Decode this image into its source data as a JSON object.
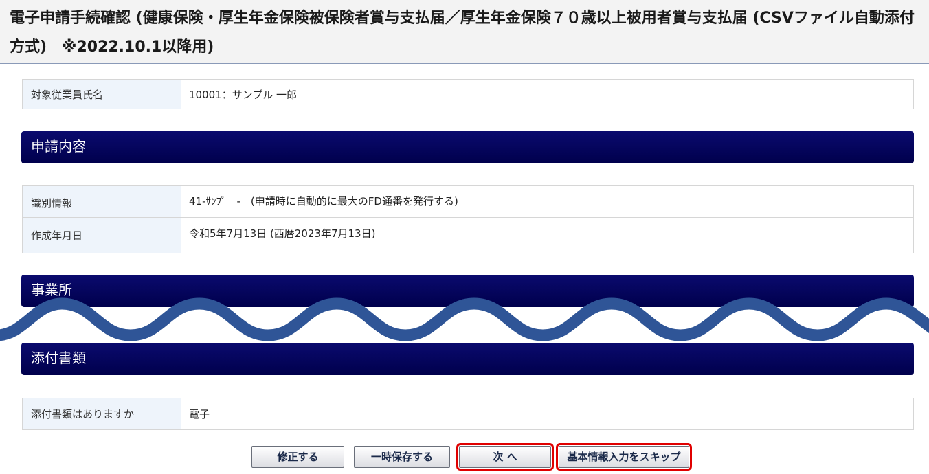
{
  "header": {
    "title": "電子申請手続確認 (健康保険・厚生年金保険被保険者賞与支払届／厚生年金保険７０歳以上被用者賞与支払届 (CSVファイル自動添付方式)　※2022.10.1以降用)"
  },
  "employee": {
    "label": "対象従業員氏名",
    "value": "10001：サンプル 一郎"
  },
  "sections": {
    "application": "申請内容",
    "office": "事業所",
    "attachments": "添付書類"
  },
  "application": {
    "rows": [
      {
        "label": "識別情報",
        "value": "41-ｻﾝﾌﾟ　-　(申請時に自動的に最大のFD通番を発行する)"
      },
      {
        "label": "作成年月日",
        "value": "令和5年7月13日 (西暦2023年7月13日)"
      }
    ]
  },
  "attachments": {
    "label": "添付書類はありますか",
    "value": "電子"
  },
  "buttons": {
    "modify": "修正する",
    "save_temp": "一時保存する",
    "next": "次 へ",
    "skip": "基本情報入力をスキップ"
  },
  "colors": {
    "section_header": "#00004c",
    "highlight": "#e00000",
    "wave": "#2f5597"
  }
}
